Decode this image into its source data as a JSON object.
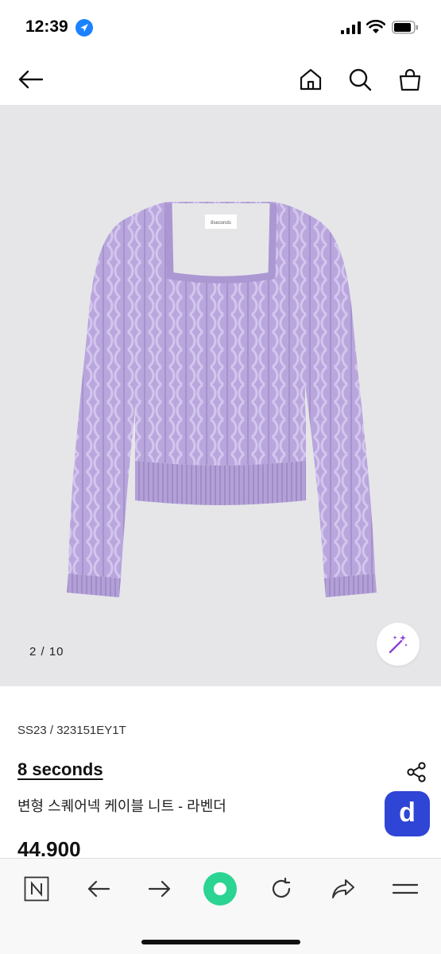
{
  "status_bar": {
    "time": "12:39"
  },
  "gallery": {
    "page_counter": "2 / 10"
  },
  "product": {
    "season_code": "SS23 / 323151EY1T",
    "brand": "8 seconds",
    "name": "변형 스퀘어넥 케이블 니트 - 라벤더",
    "price": "44.900",
    "d_badge": "d",
    "garment_label": "8seconds"
  },
  "colors": {
    "lavender": "#b9a6dd",
    "accent_blue": "#2f45d6",
    "backdrop": "#e6e6e8"
  },
  "icons": {
    "top_nav": [
      "back-arrow-icon",
      "home-icon",
      "search-icon",
      "shopping-bag-icon"
    ],
    "browser_toolbar": [
      "naver-n-icon",
      "back-icon",
      "forward-icon",
      "green-dot-icon",
      "refresh-icon",
      "share-icon",
      "menu-icon"
    ]
  }
}
